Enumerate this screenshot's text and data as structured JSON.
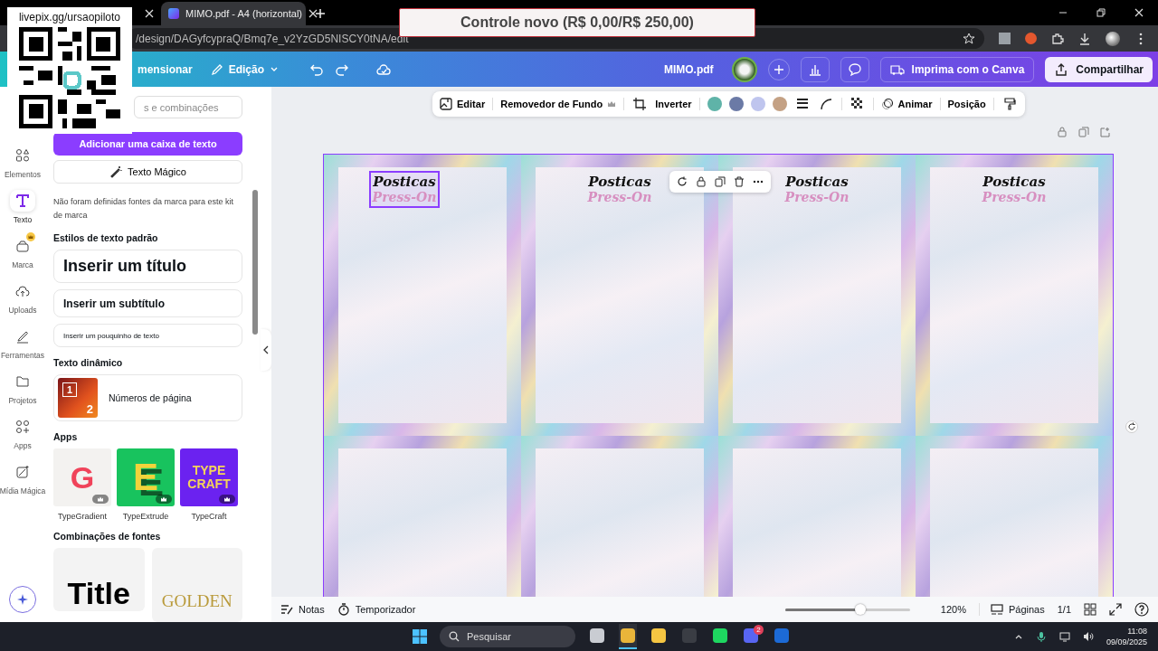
{
  "stream_overlay": {
    "link": "livepix.gg/ursaopiloto"
  },
  "donation_banner": {
    "text": "Controle novo (R$ 0,00/R$ 250,00)"
  },
  "browser": {
    "tabs": [
      {
        "title": "MIMO.pdf - A4 (horizontal)",
        "selected": true
      }
    ],
    "url": "/design/DAGyfcypraQ/Bmq7e_v2YzGD5NISCY0tNA/edit"
  },
  "header": {
    "resize": "mensionar",
    "edit_menu": "Edição",
    "file_name": "MIMO.pdf",
    "print": "Imprima com o Canva",
    "share": "Compartilhar"
  },
  "rail": [
    {
      "kind": "elements",
      "label": "Elementos",
      "selected": false
    },
    {
      "kind": "text",
      "label": "Texto",
      "selected": true
    },
    {
      "kind": "brand",
      "label": "Marca",
      "selected": false
    },
    {
      "kind": "uploads",
      "label": "Uploads",
      "selected": false
    },
    {
      "kind": "tools",
      "label": "Ferramentas",
      "selected": false
    },
    {
      "kind": "projects",
      "label": "Projetos",
      "selected": false
    },
    {
      "kind": "apps",
      "label": "Apps",
      "selected": false
    },
    {
      "kind": "magic",
      "label": "Mídia Mágica",
      "selected": false
    }
  ],
  "panel": {
    "search_placeholder": "s e combinações",
    "add_text": "Adicionar uma caixa de texto",
    "magic_text": "Texto Mágico",
    "brand_note": "Não foram definidas fontes da marca para este kit de marca",
    "styles_heading": "Estilos de texto padrão",
    "styles": [
      {
        "kind": "title",
        "label": "Inserir um título"
      },
      {
        "kind": "subtitle",
        "label": "Inserir um subtítulo"
      },
      {
        "kind": "body",
        "label": "Inserir um pouquinho de texto"
      }
    ],
    "dynamic_heading": "Texto dinâmico",
    "page_numbers": {
      "label": "Números de página",
      "digits": [
        "1",
        "2"
      ]
    },
    "apps_heading": "Apps",
    "apps": [
      {
        "kind": "gradient",
        "name": "TypeGradient",
        "tile_text": "G"
      },
      {
        "kind": "extrude",
        "name": "TypeExtrude",
        "tile_text": "E"
      },
      {
        "kind": "craft",
        "name": "TypeCraft",
        "tile_text": "TYPE CRAFT"
      }
    ],
    "combos_heading": "Combinações de fontes",
    "combos": [
      {
        "kind": "bold",
        "text": "Title"
      },
      {
        "kind": "serif",
        "text": "GOLDEN"
      }
    ]
  },
  "toolbar": {
    "edit": "Editar",
    "bg_remover": "Removedor de Fundo",
    "flip": "Inverter",
    "colors": [
      {
        "color": "#5fb3a8"
      },
      {
        "color": "#6b7aa6"
      },
      {
        "color": "#bfc5ee"
      },
      {
        "color": "#c4a184"
      }
    ],
    "animate": "Animar",
    "position": "Posição"
  },
  "design": {
    "tiles": [
      {
        "kind": "titled",
        "title": "Posticas",
        "subtitle": "Press-On",
        "selected": true
      },
      {
        "kind": "titled",
        "title": "Posticas",
        "subtitle": "Press-On",
        "selected": false
      },
      {
        "kind": "titled",
        "title": "Posticas",
        "subtitle": "Press-On",
        "selected": false
      },
      {
        "kind": "titled",
        "title": "Posticas",
        "subtitle": "Press-On",
        "selected": false
      },
      {
        "kind": "blank"
      },
      {
        "kind": "blank"
      },
      {
        "kind": "blank"
      },
      {
        "kind": "blank"
      }
    ]
  },
  "footer": {
    "notes": "Notas",
    "timer": "Temporizador",
    "zoom": {
      "level": 0.6
    },
    "zoom_label": "120%",
    "pages": "Páginas",
    "page_count": "1/1"
  },
  "taskbar": {
    "search_placeholder": "Pesquisar",
    "apps": [
      {
        "kind": "taskview",
        "active": false
      },
      {
        "kind": "chrome",
        "active": true
      },
      {
        "kind": "folder",
        "active": false
      },
      {
        "kind": "recorder",
        "active": false
      },
      {
        "kind": "spotify",
        "active": false
      },
      {
        "kind": "discord",
        "active": false,
        "badge": "2"
      },
      {
        "kind": "paypal",
        "active": false
      }
    ],
    "time": "11:08",
    "date": "09/09/2025"
  }
}
